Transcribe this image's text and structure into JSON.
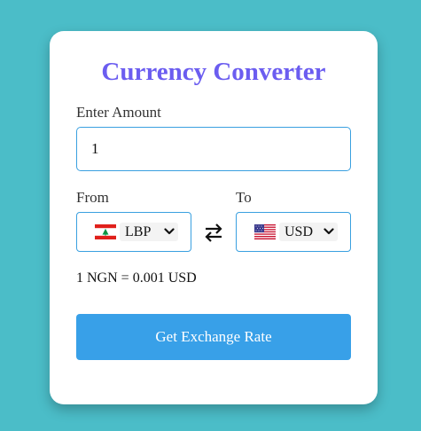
{
  "app": {
    "title": "Currency Converter"
  },
  "amount": {
    "label": "Enter Amount",
    "value": "1"
  },
  "from": {
    "label": "From",
    "currency": "LBP",
    "flag_icon": "lebanon-flag-icon"
  },
  "to": {
    "label": "To",
    "currency": "USD",
    "flag_icon": "usa-flag-icon"
  },
  "swap_icon": "swap-arrows-icon",
  "rate": {
    "text": "1 NGN = 0.001 USD"
  },
  "button": {
    "label": "Get Exchange Rate"
  },
  "colors": {
    "background": "#4bbdc8",
    "title": "#6b5df0",
    "accent": "#38a0e8",
    "border": "#3aa0e0"
  }
}
